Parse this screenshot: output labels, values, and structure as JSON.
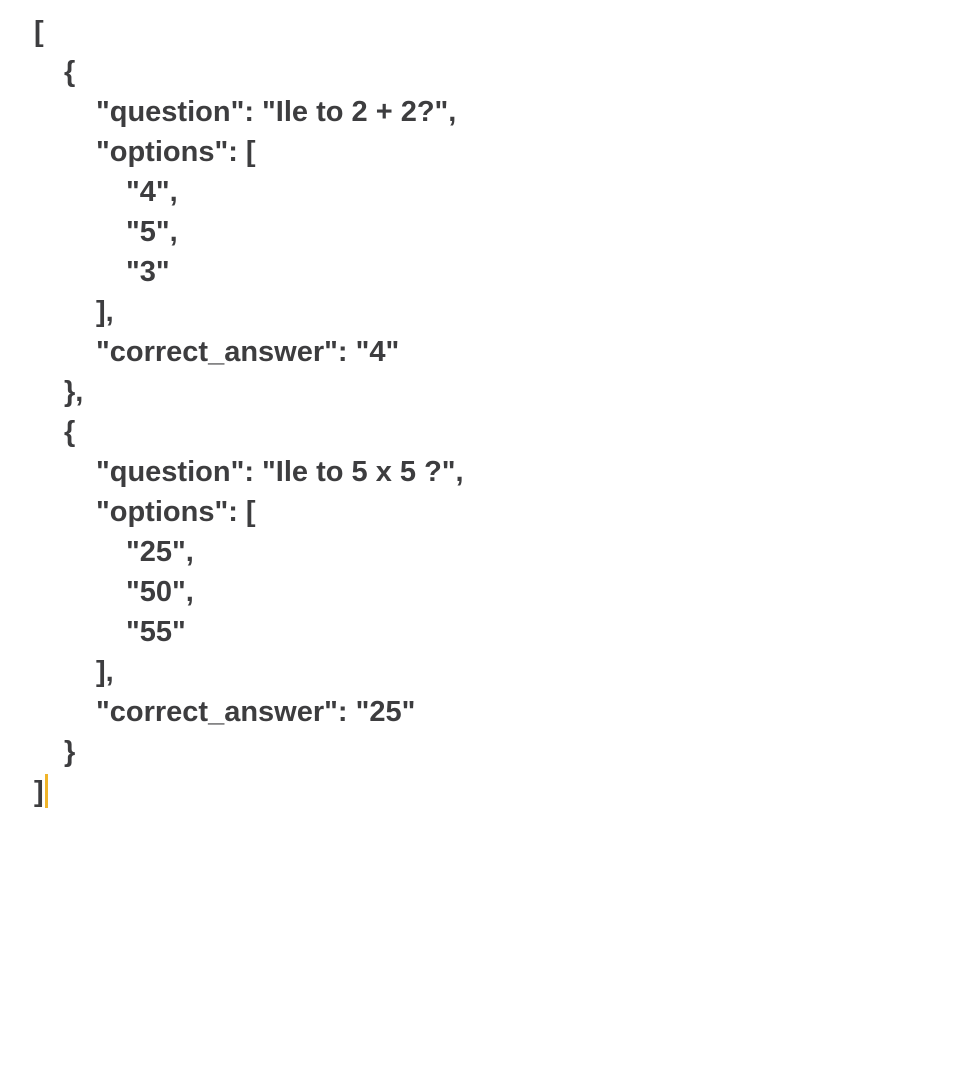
{
  "editor": {
    "lines": [
      "[",
      "{",
      "\"question\": \"Ile to 2 + 2?\",",
      "\"options\": [",
      "\"4\",",
      "\"5\",",
      "\"3\"",
      "],",
      "\"correct_answer\": \"4\"",
      "},",
      "{",
      "\"question\": \"Ile to 5 x 5 ?\",",
      "\"options\": [",
      "\"25\",",
      "\"50\",",
      "\"55\"",
      "],",
      "\"correct_answer\": \"25\"",
      "}",
      "]"
    ],
    "caret_color": "#f0b429",
    "text_color": "#3d3d3f"
  }
}
